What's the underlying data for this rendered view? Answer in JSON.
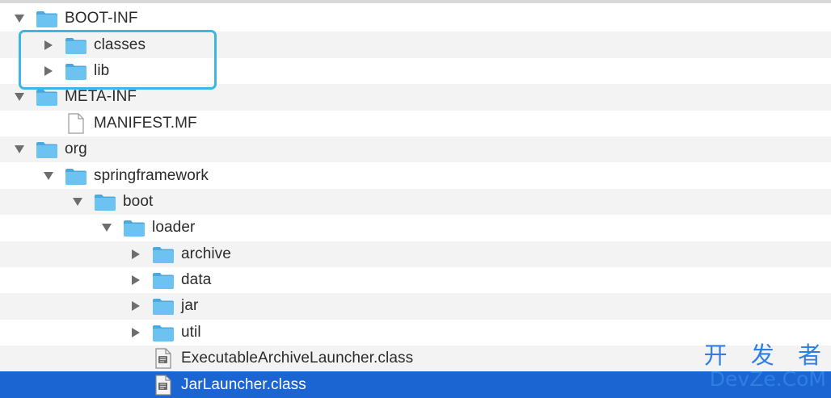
{
  "tree": {
    "items": [
      {
        "label": "BOOT-INF",
        "depth": 0,
        "expanded": true,
        "type": "folder"
      },
      {
        "label": "classes",
        "depth": 1,
        "expanded": false,
        "type": "folder"
      },
      {
        "label": "lib",
        "depth": 1,
        "expanded": false,
        "type": "folder"
      },
      {
        "label": "META-INF",
        "depth": 0,
        "expanded": true,
        "type": "folder"
      },
      {
        "label": "MANIFEST.MF",
        "depth": 1,
        "type": "file"
      },
      {
        "label": "org",
        "depth": 0,
        "expanded": true,
        "type": "folder"
      },
      {
        "label": "springframework",
        "depth": 1,
        "expanded": true,
        "type": "folder"
      },
      {
        "label": "boot",
        "depth": 2,
        "expanded": true,
        "type": "folder"
      },
      {
        "label": "loader",
        "depth": 3,
        "expanded": true,
        "type": "folder"
      },
      {
        "label": "archive",
        "depth": 4,
        "expanded": false,
        "type": "folder"
      },
      {
        "label": "data",
        "depth": 4,
        "expanded": false,
        "type": "folder"
      },
      {
        "label": "jar",
        "depth": 4,
        "expanded": false,
        "type": "folder"
      },
      {
        "label": "util",
        "depth": 4,
        "expanded": false,
        "type": "folder"
      },
      {
        "label": "ExecutableArchiveLauncher.class",
        "depth": 4,
        "type": "class-file"
      },
      {
        "label": "JarLauncher.class",
        "depth": 4,
        "type": "class-file",
        "selected": true
      }
    ]
  },
  "watermark": {
    "line1": "开 发 者",
    "line2": "DevZe.CoM"
  },
  "colors": {
    "folder": "#5cb9ec",
    "selection": "#1b65d3",
    "highlight_border": "#3bb6e8",
    "watermark": "#2f7fe0"
  },
  "icons": {
    "folder": "folder-icon",
    "file": "file-icon",
    "class_file": "java-class-file-icon",
    "expanded": "triangle-down-icon",
    "collapsed": "triangle-right-icon"
  }
}
